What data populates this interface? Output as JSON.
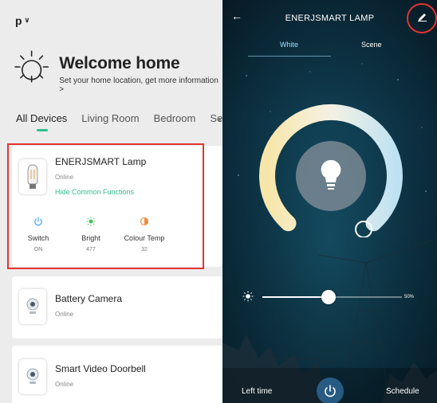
{
  "home": {
    "name": "p"
  },
  "welcome": {
    "title": "Welcome home",
    "subtitle": "Set your home location, get more information >"
  },
  "tabs": [
    "All Devices",
    "Living Room",
    "Bedroom",
    "Seco"
  ],
  "devices": [
    {
      "name": "ENERJSMART Lamp",
      "status": "Online",
      "hide_link": "Hide Common Functions",
      "functions": [
        {
          "label": "Switch",
          "value": "ON",
          "icon": "power-icon",
          "color": "#3ea6e8"
        },
        {
          "label": "Bright",
          "value": "477",
          "icon": "brightness-icon",
          "color": "#3fbf5a"
        },
        {
          "label": "Colour Temp",
          "value": "32",
          "icon": "colour-temp-icon",
          "color": "#f08a3c"
        }
      ]
    },
    {
      "name": "Battery Camera",
      "status": "Online",
      "icon": "camera-icon"
    },
    {
      "name": "Smart Video Doorbell",
      "status": "Online",
      "icon": "doorbell-icon"
    }
  ],
  "lamp_control": {
    "title": "ENERJSMART LAMP",
    "tabs": [
      "White",
      "Scene"
    ],
    "active_tab": "White",
    "brightness_percent": 50,
    "brightness_label": "50%",
    "footer": {
      "left": "Left time",
      "right": "Schedule"
    }
  },
  "colors": {
    "accent_green": "#2fbf8f",
    "highlight_red": "#e3342f",
    "warm": "#f6e9b8",
    "cool": "#bfe4f3"
  }
}
